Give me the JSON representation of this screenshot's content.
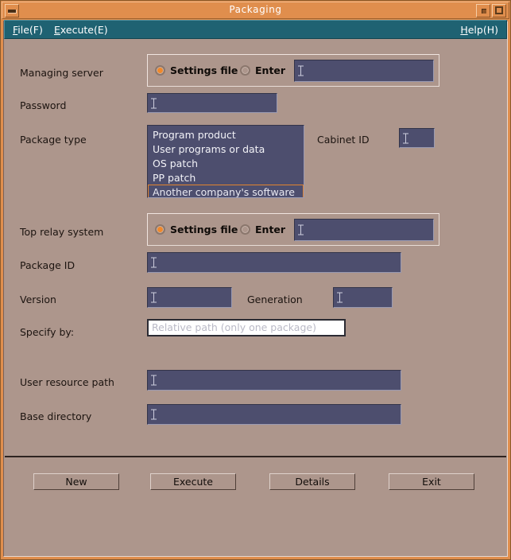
{
  "window": {
    "title": "Packaging",
    "controls": {
      "menu_button": "window-menu",
      "minimize_button": "minimize",
      "maximize_button": "maximize"
    }
  },
  "menubar": {
    "items": [
      {
        "id": "file",
        "label": "File(F)",
        "mnemonic": "F"
      },
      {
        "id": "execute",
        "label": "Execute(E)",
        "mnemonic": "E"
      },
      {
        "id": "help",
        "label": "Help(H)",
        "mnemonic": "H"
      }
    ]
  },
  "form": {
    "managing_server": {
      "label": "Managing server",
      "radio_settings_file": "Settings file",
      "radio_enter": "Enter",
      "selected": "Settings file",
      "value": ""
    },
    "password": {
      "label": "Password",
      "value": ""
    },
    "package_type": {
      "label": "Package type",
      "options": [
        "Program product",
        "User programs or data",
        "OS patch",
        "PP patch",
        "Another company's software"
      ],
      "selected": "Another company's software"
    },
    "cabinet_id": {
      "label": "Cabinet ID",
      "value": ""
    },
    "top_relay_system": {
      "label": "Top relay system",
      "radio_settings_file": "Settings file",
      "radio_enter": "Enter",
      "selected": "Settings file",
      "value": ""
    },
    "package_id": {
      "label": "Package ID",
      "value": ""
    },
    "version": {
      "label": "Version",
      "value": ""
    },
    "generation": {
      "label": "Generation",
      "value": ""
    },
    "specify_by": {
      "label": "Specify by:",
      "value": "Relative path (only one package)"
    },
    "user_resource_path": {
      "label": "User resource path",
      "value": ""
    },
    "base_directory": {
      "label": "Base directory",
      "value": ""
    }
  },
  "buttons": {
    "new": "New",
    "execute": "Execute",
    "details": "Details",
    "exit": "Exit"
  },
  "colors": {
    "titlebar": "#e08e4d",
    "menubar": "#1f6272",
    "surface": "#ad968c",
    "field": "#4d4e6e",
    "accent": "#f0882a",
    "selection_border": "#e2842f"
  }
}
